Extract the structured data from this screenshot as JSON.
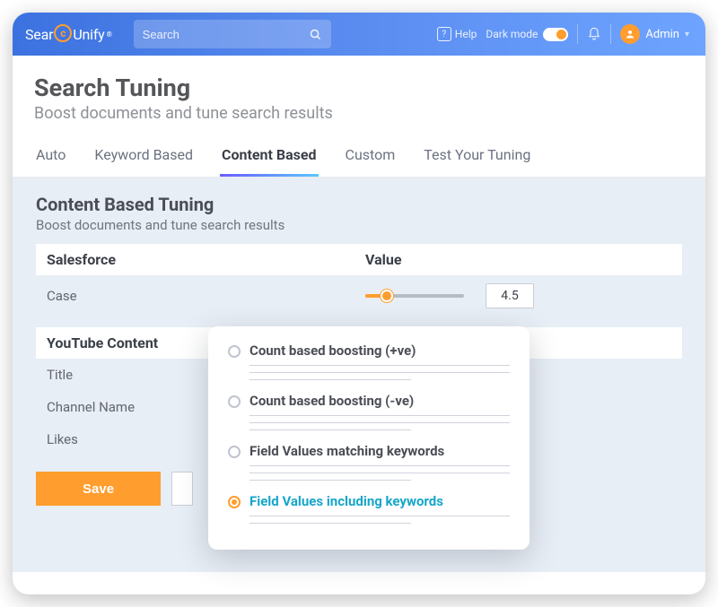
{
  "brand": {
    "name_pre": "Sear",
    "name_post": "Unify",
    "icon_letter": "c",
    "reg": "®"
  },
  "topbar": {
    "search_placeholder": "Search",
    "help_label": "Help",
    "darkmode_label": "Dark mode",
    "user_name": "Admin"
  },
  "page": {
    "title": "Search Tuning",
    "subtitle": "Boost documents and tune search results"
  },
  "tabs": [
    {
      "id": "auto",
      "label": "Auto",
      "active": false
    },
    {
      "id": "keyword",
      "label": "Keyword Based",
      "active": false
    },
    {
      "id": "content",
      "label": "Content Based",
      "active": true
    },
    {
      "id": "custom",
      "label": "Custom",
      "active": false
    },
    {
      "id": "test",
      "label": "Test Your Tuning",
      "active": false
    }
  ],
  "section": {
    "title": "Content Based Tuning",
    "subtitle": "Boost documents and tune search results"
  },
  "value_header": "Value",
  "sources": [
    {
      "name": "Salesforce",
      "rows": [
        {
          "field": "Case",
          "value": "4.5"
        }
      ]
    },
    {
      "name": "YouTube Content",
      "rows": [
        {
          "field": "Title"
        },
        {
          "field": "Channel Name"
        },
        {
          "field": "Likes"
        }
      ]
    }
  ],
  "actions": {
    "save": "Save"
  },
  "popover_options": [
    {
      "id": "count-pos",
      "label": "Count based boosting (+ve)",
      "selected": false
    },
    {
      "id": "count-neg",
      "label": "Count based boosting (-ve)",
      "selected": false
    },
    {
      "id": "fv-match",
      "label": "Field Values matching keywords",
      "selected": false
    },
    {
      "id": "fv-incl",
      "label": "Field Values including keywords",
      "selected": true
    }
  ]
}
